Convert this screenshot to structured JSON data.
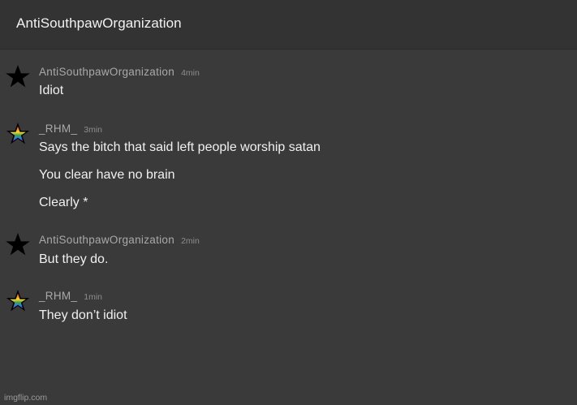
{
  "header": {
    "title": "AntiSouthpawOrganization"
  },
  "messages": [
    {
      "author": "AntiSouthpawOrganization",
      "time": "4min",
      "avatar_icon": "black-star-icon",
      "lines": [
        "Idiot"
      ]
    },
    {
      "author": "_RHM_",
      "time": "3min",
      "avatar_icon": "rainbow-star-icon",
      "lines": [
        "Says the bitch that said left people worship satan",
        "You clear have no brain",
        "Clearly *"
      ]
    },
    {
      "author": "AntiSouthpawOrganization",
      "time": "2min",
      "avatar_icon": "black-star-icon",
      "lines": [
        "But they do."
      ]
    },
    {
      "author": "_RHM_",
      "time": "1min",
      "avatar_icon": "rainbow-star-icon",
      "lines": [
        "They don’t idiot"
      ]
    }
  ],
  "watermark": "imgflip.com",
  "colors": {
    "background": "#3a3a3b",
    "text": "#f0f0f0",
    "author": "#a9a9a9"
  }
}
